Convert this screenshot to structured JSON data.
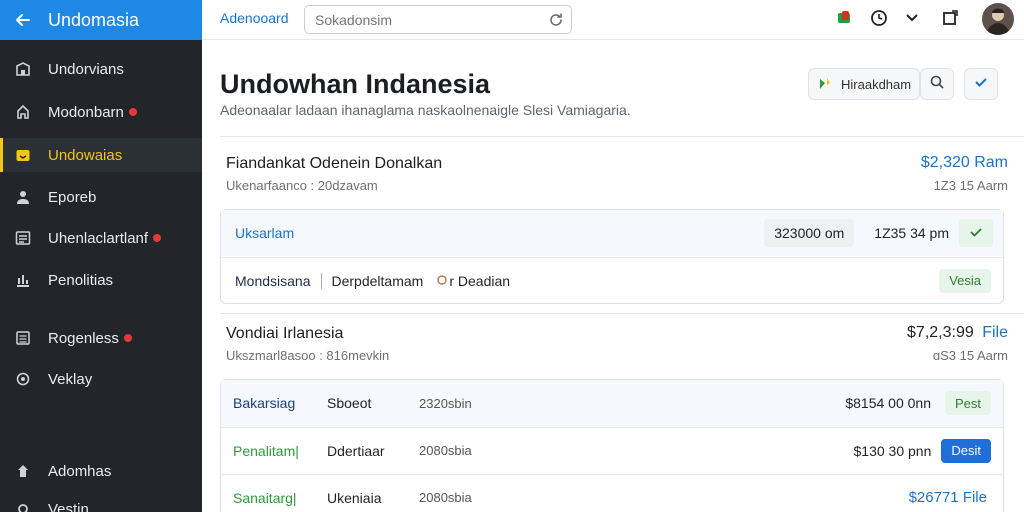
{
  "sidebar": {
    "title": "Undomasia",
    "items": [
      {
        "label": "Undorvians",
        "icon": "building-icon",
        "dot": false
      },
      {
        "label": "Modonbarn",
        "icon": "home-icon",
        "dot": true
      },
      {
        "label": "Undowaias",
        "icon": "folder-icon",
        "dot": false,
        "active": true
      },
      {
        "label": "Eporeb",
        "icon": "user-icon",
        "dot": false
      },
      {
        "label": "Uhenlaclartlanf",
        "icon": "list-icon",
        "dot": true
      },
      {
        "label": "Penolitias",
        "icon": "chart-icon",
        "dot": false
      },
      {
        "label": "Rogenless",
        "icon": "document-icon",
        "dot": true
      },
      {
        "label": "Veklay",
        "icon": "refresh-icon",
        "dot": false
      },
      {
        "label": "Adomhas",
        "icon": "person-icon",
        "dot": false
      },
      {
        "label": "Vestin",
        "icon": "settings-icon",
        "dot": false
      }
    ]
  },
  "topbar": {
    "link": "Adenooard",
    "search_placeholder": "Sokadonsim"
  },
  "header": {
    "title": "Undowhan Indanesia",
    "subtitle": "Adeonaalar ladaan ihanaglama naskaolnenaigle Slesi Vamiagaria.",
    "action_label": "Hiraakdham"
  },
  "section1": {
    "title": "Fiandankat Odenein Donalkan",
    "subtitle": "Ukenarfaanco : 20dzavam",
    "amount": "$2,320 Ram",
    "time": "1Z3 15 Aarm",
    "card": {
      "row1": {
        "label": "Uksarlam",
        "amount": "323000 om",
        "time": "1Z35 34 pm"
      },
      "row2": {
        "label": "Mondsisana",
        "col2": "Derpdeltamam",
        "col3": "r Deadian",
        "badge": "Vesia"
      }
    }
  },
  "section2": {
    "title": "Vondiai Irlanesia",
    "subtitle": "Ukszmarl8asoo : 816mevkin",
    "amount": "$7,2,3:99",
    "amount_suffix": "File",
    "time": "ɑS3 15 Aarm",
    "rows": [
      {
        "label": "Bakarsiag",
        "col2": "Sboeot",
        "col3": "2320sbin",
        "amount": "$8154 00 0nn",
        "badge": "Pest",
        "badge_style": "green",
        "label_color": "#1d3f7a"
      },
      {
        "label": "Penalitam|",
        "col2": "Ddertiaar",
        "col3": "2080sbia",
        "amount": "$130 30 pnn",
        "badge": "Desit",
        "badge_style": "blue",
        "label_color": "#2e9b3a"
      },
      {
        "label": "Sanaitarg|",
        "col2": "Ukeniaia",
        "col3": "2080sbia",
        "amount": "$26771 File",
        "badge": "",
        "badge_style": "none",
        "label_color": "#2e9b3a"
      }
    ]
  },
  "colors": {
    "accent": "#1e88e5",
    "sidebar_bg": "#22262b",
    "active": "#f5c518",
    "link": "#1a73c9"
  }
}
